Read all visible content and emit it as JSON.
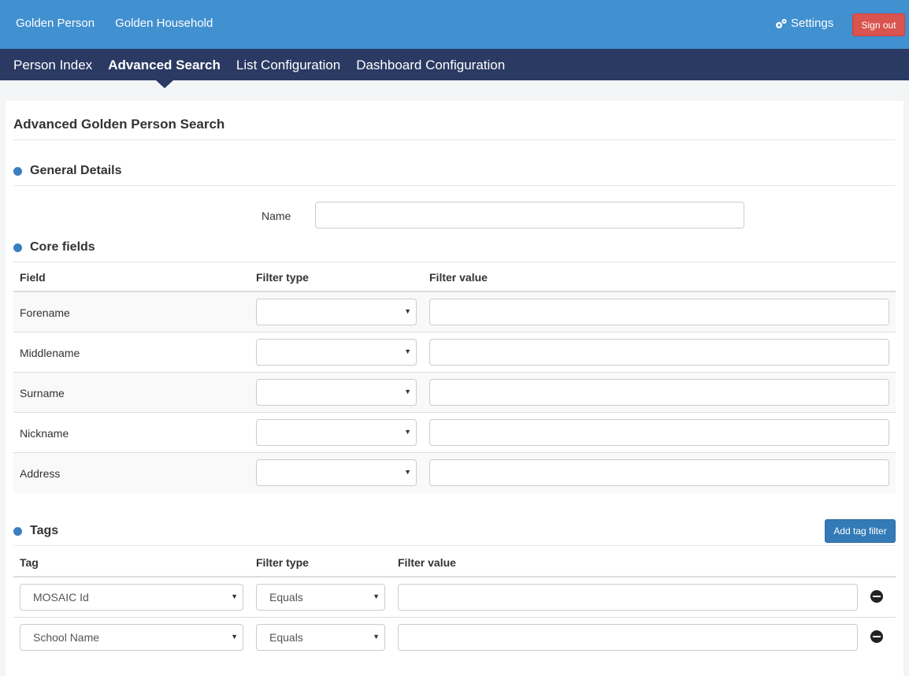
{
  "topbar": {
    "links": [
      "Golden Person",
      "Golden Household"
    ],
    "settings_label": "Settings",
    "settings_icon": "gears-icon",
    "signout_label": "Sign out"
  },
  "nav": {
    "items": [
      "Person Index",
      "Advanced Search",
      "List Configuration",
      "Dashboard Configuration"
    ],
    "active": "Advanced Search"
  },
  "page": {
    "title": "Advanced Golden Person Search"
  },
  "general": {
    "heading": "General Details",
    "name_label": "Name",
    "name_value": ""
  },
  "core": {
    "heading": "Core fields",
    "headers": [
      "Field",
      "Filter type",
      "Filter value"
    ],
    "rows": [
      {
        "field": "Forename",
        "filter_type": "",
        "filter_value": ""
      },
      {
        "field": "Middlename",
        "filter_type": "",
        "filter_value": ""
      },
      {
        "field": "Surname",
        "filter_type": "",
        "filter_value": ""
      },
      {
        "field": "Nickname",
        "filter_type": "",
        "filter_value": ""
      },
      {
        "field": "Address",
        "filter_type": "",
        "filter_value": ""
      }
    ]
  },
  "tags": {
    "heading": "Tags",
    "add_button": "Add tag filter",
    "headers": [
      "Tag",
      "Filter type",
      "Filter value"
    ],
    "rows": [
      {
        "tag": "MOSAIC Id",
        "filter_type": "Equals",
        "filter_value": ""
      },
      {
        "tag": "School Name",
        "filter_type": "Equals",
        "filter_value": ""
      }
    ]
  },
  "colors": {
    "topbar": "#4190d0",
    "navbar": "#2b3a63",
    "signout": "#d9534f",
    "primary": "#337ab7",
    "bullet": "#3a7fc1"
  }
}
